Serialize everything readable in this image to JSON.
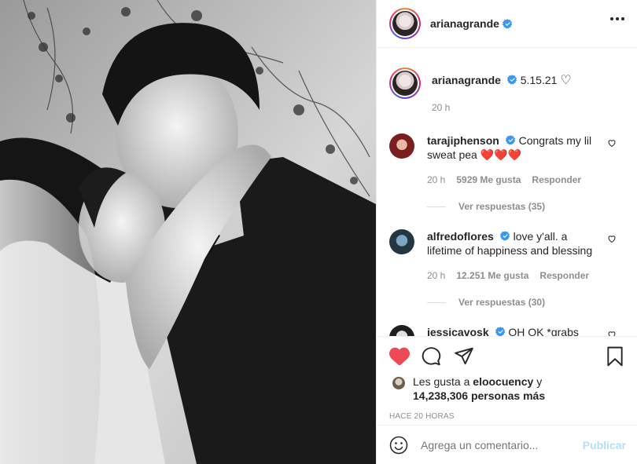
{
  "author": {
    "username": "arianagrande",
    "verified": true
  },
  "caption": {
    "text": "5.15.21",
    "time": "20 h"
  },
  "comments": [
    {
      "username": "tarajiphenson",
      "text": "Congrats my lil sweat pea",
      "emoji": "❤️❤️❤️",
      "time": "20 h",
      "likes": "5929 Me gusta",
      "reply": "Responder",
      "view_replies": "Ver respuestas (35)"
    },
    {
      "username": "alfredoflores",
      "text": "love y'all. a lifetime of happiness and blessing",
      "time": "20 h",
      "likes": "12.251 Me gusta",
      "reply": "Responder",
      "view_replies": "Ver respuestas (30)"
    },
    {
      "username": "jessicavosk",
      "text": "OH OK *grabs"
    }
  ],
  "likes": {
    "prefix": "Les gusta a ",
    "user": "eloocuency",
    "middle": " y",
    "count": "14,238,306 personas más"
  },
  "posted": "HACE 20 HORAS",
  "add_comment": {
    "placeholder": "Agrega un comentario...",
    "publish": "Publicar"
  },
  "icons": {
    "like": "heart-filled-icon",
    "comment": "comment-icon",
    "share": "share-icon",
    "save": "bookmark-icon",
    "emoji": "emoji-icon",
    "more": "more-icon",
    "verified": "verified-badge-icon"
  },
  "colors": {
    "heart": "#ed4956",
    "verified": "#3897f0",
    "publish": "#b2dffc"
  }
}
